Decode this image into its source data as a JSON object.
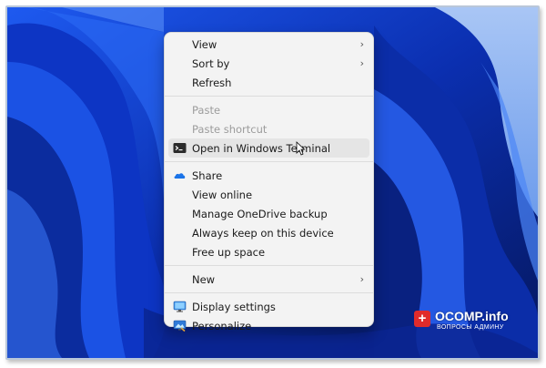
{
  "menu": {
    "items": [
      {
        "label": "View",
        "submenu": true
      },
      {
        "label": "Sort by",
        "submenu": true
      },
      {
        "label": "Refresh"
      },
      {
        "label": "Paste",
        "disabled": true
      },
      {
        "label": "Paste shortcut",
        "disabled": true
      },
      {
        "label": "Open in Windows Terminal",
        "icon": "terminal-icon",
        "hovered": true
      },
      {
        "label": "Share",
        "icon": "onedrive-cloud-icon"
      },
      {
        "label": "View online"
      },
      {
        "label": "Manage OneDrive backup"
      },
      {
        "label": "Always keep on this device"
      },
      {
        "label": "Free up space"
      },
      {
        "label": "New",
        "submenu": true
      },
      {
        "label": "Display settings",
        "icon": "display-settings-icon"
      },
      {
        "label": "Personalize",
        "icon": "personalize-icon"
      }
    ]
  },
  "watermark": {
    "icon_glyph": "+",
    "title": "OCOMP.info",
    "subtitle": "ВОПРОСЫ АДМИНУ"
  },
  "colors": {
    "menu_bg": "#f3f3f3",
    "hover_bg": "#e5e5e5",
    "disabled_text": "#9c9c9c",
    "wallpaper_blue": "#1747d6",
    "watermark_red": "#e02b2b"
  }
}
